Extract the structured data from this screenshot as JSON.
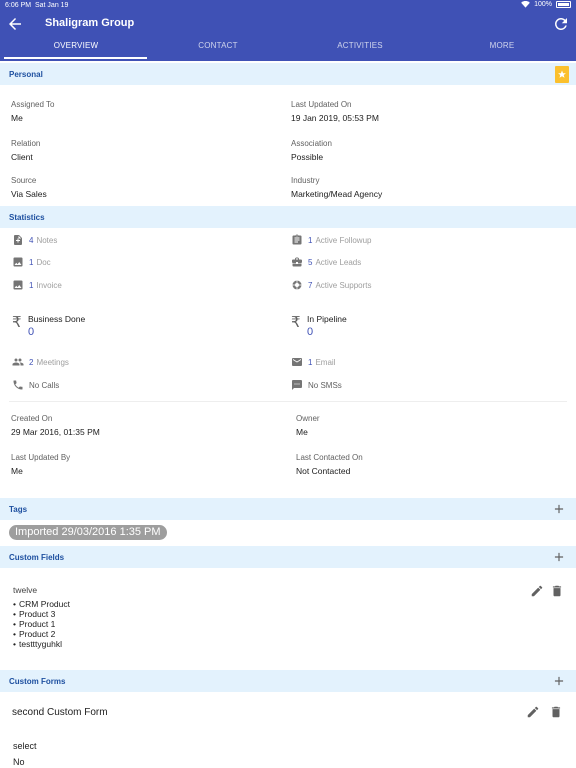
{
  "status": {
    "time": "6:06 PM",
    "date": "Sat Jan 19",
    "battery": "100%"
  },
  "header": {
    "title": "Shaligram Group"
  },
  "tabs": [
    {
      "label": "OVERVIEW",
      "active": true
    },
    {
      "label": "CONTACT",
      "active": false
    },
    {
      "label": "ACTIVITIES",
      "active": false
    },
    {
      "label": "MORE",
      "active": false
    }
  ],
  "personal": {
    "title": "Personal",
    "assigned_to_label": "Assigned To",
    "assigned_to": "Me",
    "last_updated_on_label": "Last Updated On",
    "last_updated_on": "19 Jan 2019, 05:53 PM",
    "relation_label": "Relation",
    "relation": "Client",
    "association_label": "Association",
    "association": "Possible",
    "source_label": "Source",
    "source": "Via Sales",
    "industry_label": "Industry",
    "industry": "Marketing/Mead Agency"
  },
  "statistics": {
    "title": "Statistics",
    "notes": {
      "count": "4",
      "label": "Notes"
    },
    "followup": {
      "count": "1",
      "label": "Active Followup"
    },
    "doc": {
      "count": "1",
      "label": "Doc"
    },
    "leads": {
      "count": "5",
      "label": "Active Leads"
    },
    "invoice": {
      "count": "1",
      "label": "Invoice"
    },
    "supports": {
      "count": "7",
      "label": "Active Supports"
    },
    "business_done": {
      "label": "Business Done",
      "value": "0"
    },
    "in_pipeline": {
      "label": "In Pipeline",
      "value": "0"
    },
    "meetings": {
      "count": "2",
      "label": "Meetings"
    },
    "email": {
      "count": "1",
      "label": "Email"
    },
    "calls": {
      "label": "No Calls"
    },
    "sms": {
      "label": "No SMSs"
    },
    "created_on_label": "Created On",
    "created_on": "29 Mar 2016, 01:35 PM",
    "owner_label": "Owner",
    "owner": "Me",
    "last_updated_by_label": "Last Updated By",
    "last_updated_by": "Me",
    "last_contacted_label": "Last Contacted On",
    "last_contacted": "Not Contacted"
  },
  "tags": {
    "title": "Tags",
    "items": [
      "Imported 29/03/2016 1:35 PM"
    ]
  },
  "custom_fields": {
    "title": "Custom Fields",
    "field_label": "twelve",
    "values": [
      "CRM Product",
      "Product 3",
      "Product 1",
      "Product 2",
      "testttyguhkl"
    ]
  },
  "custom_forms": {
    "title": "Custom Forms",
    "form_title": "second Custom Form",
    "field_label": "select",
    "field_value": "No"
  },
  "colors": {
    "primary": "#3f51b5",
    "section_bg": "#e3f2fd",
    "bookmark": "#fbc02d"
  }
}
